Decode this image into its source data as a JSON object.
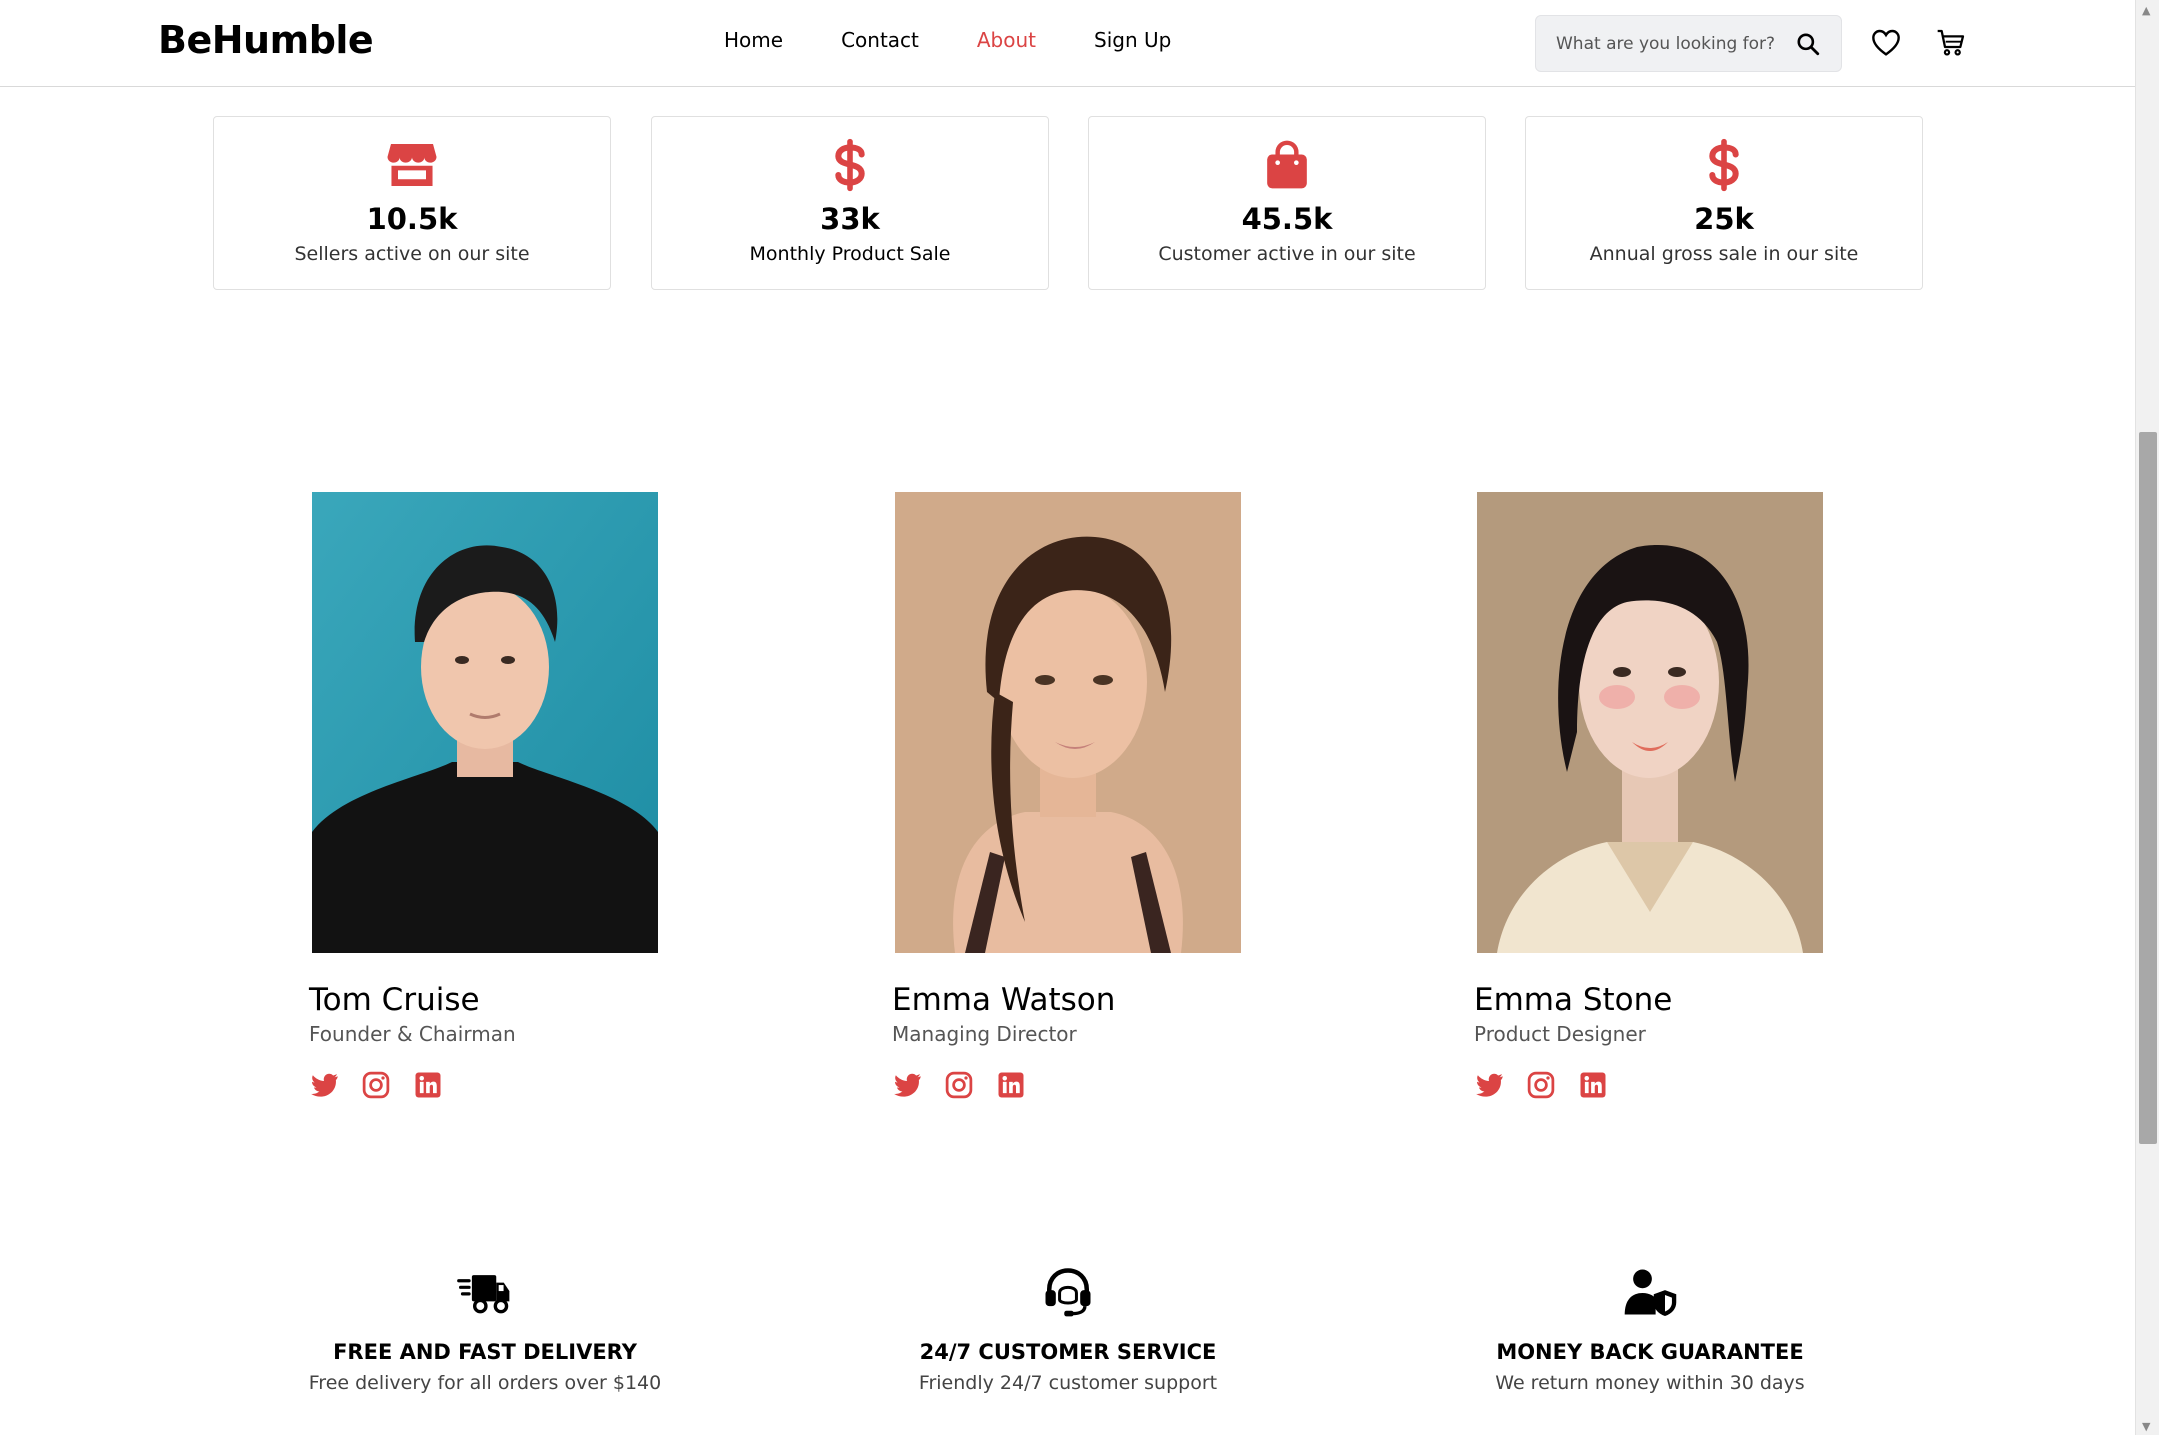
{
  "header": {
    "logo": "BeHumble",
    "nav": [
      {
        "label": "Home",
        "active": false
      },
      {
        "label": "Contact",
        "active": false
      },
      {
        "label": "About",
        "active": true
      },
      {
        "label": "Sign Up",
        "active": false
      }
    ],
    "search": {
      "placeholder": "What are you looking for?",
      "icon": "search-icon"
    },
    "icons": [
      "heart-icon",
      "cart-icon"
    ]
  },
  "stats": [
    {
      "icon": "store-icon",
      "value": "10.5k",
      "label": "Sellers active on our site"
    },
    {
      "icon": "dollar-icon",
      "value": "33k",
      "label": "Monthly Product Sale"
    },
    {
      "icon": "shopping-bag-icon",
      "value": "45.5k",
      "label": "Customer active in our site"
    },
    {
      "icon": "dollar-icon",
      "value": "25k",
      "label": "Annual gross sale in our site"
    }
  ],
  "team": [
    {
      "name": "Tom Cruise",
      "role": "Founder & Chairman",
      "socials": [
        "twitter-icon",
        "instagram-icon",
        "linkedin-icon"
      ]
    },
    {
      "name": "Emma Watson",
      "role": "Managing Director",
      "socials": [
        "twitter-icon",
        "instagram-icon",
        "linkedin-icon"
      ]
    },
    {
      "name": "Emma Stone",
      "role": "Product Designer",
      "socials": [
        "twitter-icon",
        "instagram-icon",
        "linkedin-icon"
      ]
    }
  ],
  "services": [
    {
      "icon": "delivery-truck-icon",
      "title": "FREE AND FAST DELIVERY",
      "desc": "Free delivery for all orders over $140"
    },
    {
      "icon": "headset-icon",
      "title": "24/7 CUSTOMER SERVICE",
      "desc": "Friendly 24/7 customer support"
    },
    {
      "icon": "shield-user-icon",
      "title": "MONEY BACK GUARANTEE",
      "desc": "We return money within 30 days"
    }
  ],
  "colors": {
    "accent": "#db4444",
    "text": "#000000",
    "muted": "#555555"
  }
}
